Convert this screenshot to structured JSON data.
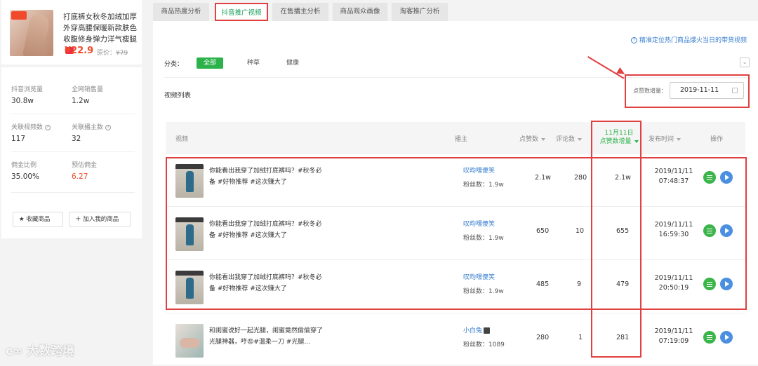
{
  "product": {
    "title": "打底裤女秋冬加绒加厚外穿高腰保暖新款肤色收腹修身弹力洋气瘦腿",
    "price": "¥22.9",
    "orig_label": "原价：",
    "orig_price": "¥79"
  },
  "stats": [
    {
      "label": "抖音浏览量",
      "value": "30.8w"
    },
    {
      "label": "全网销售量",
      "value": "1.2w"
    },
    {
      "label": "关联视频数",
      "value": "117"
    },
    {
      "label": "关联播主数",
      "value": "32"
    },
    {
      "label": "佣金比例",
      "value": "35.00%"
    },
    {
      "label": "预估佣金",
      "value": "6.27"
    }
  ],
  "buttons": {
    "favorite": "收藏商品",
    "add": "加入我的商品"
  },
  "tabs": [
    "商品热度分析",
    "抖音推广视频",
    "在售播主分析",
    "商品观众画像",
    "淘客推广分析"
  ],
  "help_link": "精准定位热门商品爆火当日的带货视频",
  "filter": {
    "label": "分类：",
    "options": [
      "全部",
      "种草",
      "健康"
    ]
  },
  "list_title": "视频列表",
  "date_filter": {
    "label": "点赞数增量：",
    "value": "2019-11-11"
  },
  "table": {
    "headers": {
      "video": "视频",
      "host": "播主",
      "likes": "点赞数",
      "comments": "评论数",
      "inc_line1": "11月11日",
      "inc_line2": "点赞数增量",
      "time": "发布时间",
      "ops": "操作"
    },
    "rows": [
      {
        "text": "你能看出我穿了加绒打底裤吗？#秋冬必备 #好物推荐 #这次赚大了",
        "host": "叹昀嘿傻笑",
        "fans": "粉丝数：1.9w",
        "likes": "2.1w",
        "comments": "280",
        "inc": "2.1w",
        "date": "2019/11/11",
        "time": "07:48:37"
      },
      {
        "text": "你能看出我穿了加绒打底裤吗？#秋冬必备 #好物推荐 #这次赚大了",
        "host": "叹昀嘿傻笑",
        "fans": "粉丝数：1.9w",
        "likes": "650",
        "comments": "10",
        "inc": "655",
        "date": "2019/11/11",
        "time": "16:59:30"
      },
      {
        "text": "你能看出我穿了加绒打底裤吗？#秋冬必备 #好物推荐 #这次赚大了",
        "host": "叹昀嘿傻笑",
        "fans": "粉丝数：1.9w",
        "likes": "485",
        "comments": "9",
        "inc": "479",
        "date": "2019/11/11",
        "time": "20:50:19"
      },
      {
        "text": "和闺蜜说好一起光腿，闺蜜竟然偷偷穿了光腿神器，哼😡#温柔一刀 #光腿...",
        "host": "小白兔",
        "fans": "粉丝数：1089",
        "likes": "280",
        "comments": "1",
        "inc": "281",
        "date": "2019/11/11",
        "time": "07:19:09"
      }
    ]
  },
  "watermark": "大数跨境"
}
